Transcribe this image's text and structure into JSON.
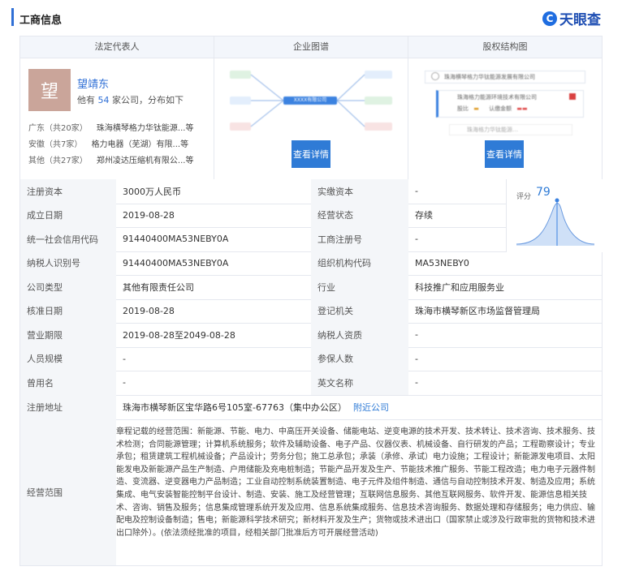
{
  "header": {
    "title": "工商信息",
    "brand": "天眼查",
    "brand_logo": "C"
  },
  "columns": {
    "legal_rep": "法定代表人",
    "graph": "企业图谱",
    "equity": "股权结构图"
  },
  "legal_rep": {
    "avatar_char": "望",
    "name": "望靖东",
    "sub_prefix": "他有",
    "count": "54",
    "sub_suffix": "家公司，分布如下",
    "regions": [
      {
        "region": "广东（共20家）",
        "company": "珠海横琴格力华钛能源...等"
      },
      {
        "region": "安徽（共7家）",
        "company": "格力电器（芜湖）有限...等"
      },
      {
        "region": "其他（共27家）",
        "company": "郑州凌达压缩机有限公...等"
      }
    ]
  },
  "graph": {
    "center_label": "XXXX有限公司",
    "button": "查看详情"
  },
  "equity": {
    "top": "珠海横琴格力华钛能源发展有限公司",
    "mid": "珠海格力能源环境技术有限公司",
    "detail1": "股比",
    "detail2": "认缴金额",
    "bottom": "珠海格力华钛能源…",
    "button": "查看详情"
  },
  "score": {
    "label": "评分",
    "value": "79"
  },
  "rows": [
    {
      "l1": "注册资本",
      "v1": "3000万人民币",
      "l2": "实缴资本",
      "v2": "-"
    },
    {
      "l1": "成立日期",
      "v1": "2019-08-28",
      "l2": "经营状态",
      "v2": "存续"
    },
    {
      "l1": "统一社会信用代码",
      "v1": "91440400MA53NEBY0A",
      "l2": "工商注册号",
      "v2": "-"
    },
    {
      "l1": "纳税人识别号",
      "v1": "91440400MA53NEBY0A",
      "l2": "组织机构代码",
      "v2": "MA53NEBY0"
    },
    {
      "l1": "公司类型",
      "v1": "其他有限责任公司",
      "l2": "行业",
      "v2": "科技推广和应用服务业"
    },
    {
      "l1": "核准日期",
      "v1": "2019-08-28",
      "l2": "登记机关",
      "v2": "珠海市横琴新区市场监督管理局"
    },
    {
      "l1": "营业期限",
      "v1": "2019-08-28至2049-08-28",
      "l2": "纳税人资质",
      "v2": "-"
    },
    {
      "l1": "人员规模",
      "v1": "-",
      "l2": "参保人数",
      "v2": "-"
    },
    {
      "l1": "曾用名",
      "v1": "-",
      "l2": "英文名称",
      "v2": "-"
    }
  ],
  "address": {
    "label": "注册地址",
    "value": "珠海市横琴新区宝华路6号105室-67763（集中办公区）",
    "link": "附近公司"
  },
  "scope": {
    "label": "经营范围",
    "text": "章程记载的经营范围：新能源、节能、电力、中高压开关设备、储能电站、逆变电源的技术开发、技术转让、技术咨询、技术服务、技术检测；合同能源管理；计算机系统服务；软件及辅助设备、电子产品、仪器仪表、机械设备、自行研发的产品；工程勘察设计；专业承包；租赁建筑工程机械设备；产品设计；劳务分包；施工总承包；承装（承修、承试）电力设施；工程设计；新能源发电项目、太阳能发电及新能源产品生产制造、户用储能及充电桩制造；节能产品开发及生产、节能技术推广服务、节能工程改造；电力电子元器件制造、变流器、逆变器电力产品制造；工业自动控制系统装置制造、电子元件及组件制造、通信与自动控制技术开发、制造及应用；系统集成、电气安装智能控制平台设计、制造、安装、施工及经营管理；互联网信息服务、其他互联网服务、软件开发、能源信息相关技术、咨询、销售及服务；信息集成管理系统开发及应用、信息系统集成服务、信息技术咨询服务、数据处理和存储服务；电力供应、输配电及控制设备制造；售电；新能源科学技术研究；新材料开发及生产；货物或技术进出口（国家禁止或涉及行政审批的货物和技术进出口除外）。(依法须经批准的项目，经相关部门批准后方可开展经营活动)"
  }
}
